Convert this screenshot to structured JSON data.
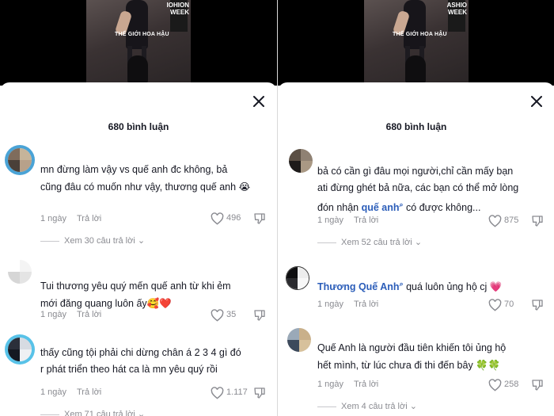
{
  "left": {
    "thumbnail": {
      "caption": "THẾ GIỚI HOA HẬU",
      "banner_text": "IOHION\nWEEK"
    },
    "title": "680 bình luận",
    "comments": [
      {
        "text_line1": "mn đừng làm vậy vs quế anh đc không, bả",
        "text_line2": "cũng đâu có muốn như vậy, thương quế anh",
        "emoji": "😭",
        "time": "1 ngày",
        "reply_label": "Trả lời",
        "likes": "496",
        "view_replies": "Xem 30 câu trả lời",
        "avatar_colors": [
          "#7f6c5c",
          "#c6b49a",
          "#4a4039",
          "#b7a18a"
        ]
      },
      {
        "text_line1": "Tui thương yêu quý mến quế anh từ khi ẻm",
        "text_line2": "mới đăng quang luôn ấy",
        "emoji": "🥰❤️",
        "time": "1 ngày",
        "reply_label": "Trả lời",
        "likes": "35",
        "view_replies": "",
        "avatar_colors": [
          "#dcdcdc",
          "#f2f2f2",
          "#c9c9c9",
          "#e8e8e8"
        ]
      },
      {
        "text_line1": "thấy cũng tội phải chi dừng chân á 2 3 4 gì đó",
        "text_line2": "r phát triển theo hát ca là mn yêu quý rồi",
        "emoji": "",
        "time": "1 ngày",
        "reply_label": "Trả lời",
        "likes": "1.117",
        "view_replies": "Xem 71 câu trả lời",
        "avatar_colors": [
          "#2b2f3a",
          "#d7dbe2",
          "#141821",
          "#eef0f3"
        ]
      }
    ]
  },
  "right": {
    "thumbnail": {
      "caption": "THẾ GIỚI HOA HẬU",
      "banner_text": "ASHIO\nWEEK"
    },
    "title": "680 bình luận",
    "comments": [
      {
        "text_line1": "bả có cần gì đâu mọi người,chỉ cần mấy bạn",
        "text_line2": "ati đừng ghét bả nữa, các bạn có thể mở lòng",
        "line3_before": "đón nhận ",
        "mention": "quế anh",
        "line3_after": " có được không...",
        "time": "1 ngày",
        "reply_label": "Trả lời",
        "likes": "875",
        "view_replies": "Xem 52 câu trả lời",
        "avatar_colors": [
          "#5b4f44",
          "#8f8173",
          "#1e1b1a",
          "#a99884"
        ]
      },
      {
        "name": "Thương Quế Anh",
        "text_after": " quá luôn ủng hộ cj ",
        "emoji": "💗",
        "time": "1 ngày",
        "reply_label": "Trả lời",
        "likes": "70",
        "view_replies": "",
        "avatar_colors": [
          "#0e0e10",
          "#ededed",
          "#2a2a2e",
          "#f7f7f7"
        ]
      },
      {
        "text_line1": "Quế Anh là người đầu tiên khiến tôi ủng hộ",
        "text_line2": "hết mình, từ lúc chưa đi thi đến bây ",
        "emoji": "🍀🍀",
        "time": "1 ngày",
        "reply_label": "Trả lời",
        "likes": "258",
        "view_replies": "Xem 4 câu trả lời",
        "avatar_colors": [
          "#9aa9b8",
          "#c9b08a",
          "#3d4a5c",
          "#d7c19c"
        ]
      }
    ]
  },
  "colors": {
    "mention": "#2b5db9",
    "muted": "#8a8b91",
    "text": "#161823"
  }
}
